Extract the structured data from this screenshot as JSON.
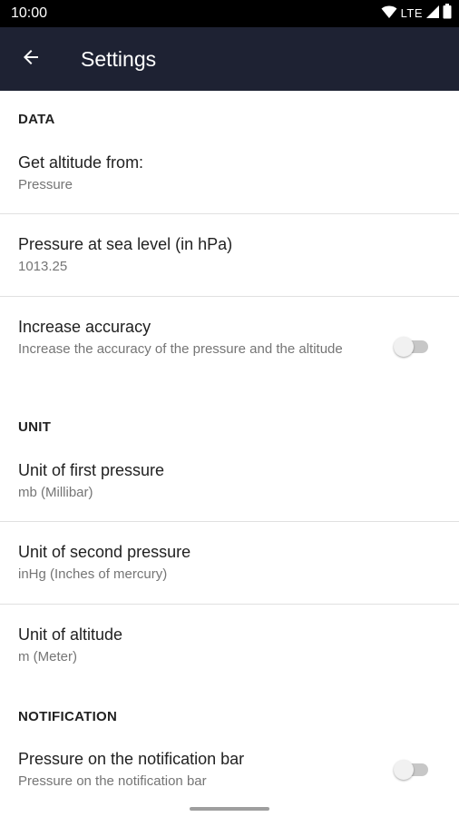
{
  "status_bar": {
    "time": "10:00",
    "network": "LTE",
    "icons": [
      "wifi-icon",
      "cell-signal-icon",
      "battery-icon"
    ]
  },
  "app_bar": {
    "title": "Settings",
    "back_icon": "arrow-left-icon"
  },
  "sections": {
    "data": {
      "header": "DATA",
      "altitude_source": {
        "title": "Get altitude from:",
        "summary": "Pressure"
      },
      "sea_level_pressure": {
        "title": "Pressure at sea level (in hPa)",
        "summary": "1013.25"
      },
      "increase_accuracy": {
        "title": "Increase accuracy",
        "summary": "Increase the accuracy of the pressure and the altitude",
        "enabled": false
      }
    },
    "unit": {
      "header": "UNIT",
      "first_pressure": {
        "title": "Unit of first pressure",
        "summary": "mb (Millibar)"
      },
      "second_pressure": {
        "title": "Unit of second pressure",
        "summary": "inHg (Inches of mercury)"
      },
      "altitude": {
        "title": "Unit of altitude",
        "summary": "m (Meter)"
      }
    },
    "notification": {
      "header": "NOTIFICATION",
      "notification_bar": {
        "title": "Pressure on the notification bar",
        "summary": "Pressure on the notification bar",
        "enabled": false
      }
    }
  },
  "colors": {
    "app_bar": "#1e2233",
    "status_bar": "#000000",
    "switch_off_track": "#c7c7c7",
    "switch_off_thumb": "#f1f1f1"
  }
}
